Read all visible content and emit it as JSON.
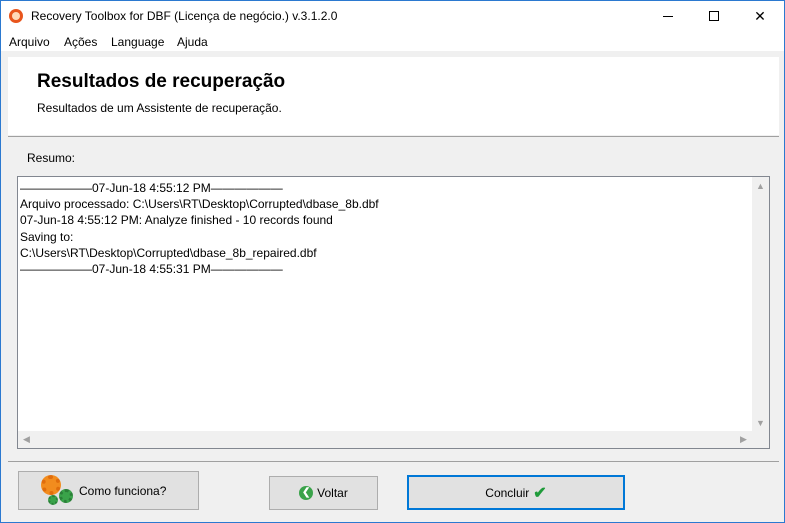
{
  "window": {
    "title": "Recovery Toolbox for DBF (Licença de negócio.) v.3.1.2.0",
    "icon": "app-logo-icon"
  },
  "menu": [
    "Arquivo",
    "Ações",
    "Language",
    "Ajuda"
  ],
  "header": {
    "title": "Resultados de recuperação",
    "subtitle": "Resultados de um Assistente de recuperação."
  },
  "summary_label": "Resumo:",
  "log": [
    "——————07-Jun-18 4:55:12 PM——————",
    "Arquivo processado: C:\\Users\\RT\\Desktop\\Corrupted\\dbase_8b.dbf",
    "07-Jun-18 4:55:12 PM: Analyze finished - 10 records found",
    "Saving to:",
    "C:\\Users\\RT\\Desktop\\Corrupted\\dbase_8b_repaired.dbf",
    "——————07-Jun-18 4:55:31 PM——————"
  ],
  "buttons": {
    "how": "Como funciona?",
    "back": "Voltar",
    "finish": "Concluir"
  },
  "colors": {
    "accent": "#0078d7",
    "check": "#1f9b3a",
    "gear_orange": "#f28c1e",
    "gear_green": "#3aa34a"
  }
}
